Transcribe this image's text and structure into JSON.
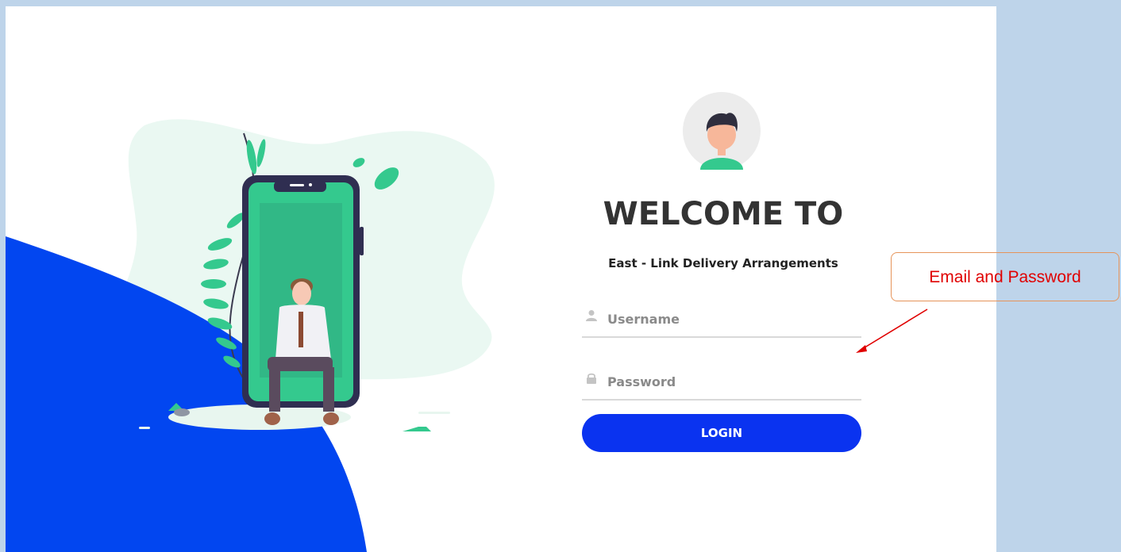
{
  "login": {
    "welcome_title": "WELCOME TO",
    "subtitle": "East - Link Delivery Arrangements",
    "username_placeholder": "Username",
    "password_placeholder": "Password",
    "login_label": "LOGIN"
  },
  "icons": {
    "avatar": "user-avatar-icon",
    "username": "user-icon",
    "password": "lock-icon"
  },
  "annotation": {
    "label": "Email and Password"
  },
  "colors": {
    "accent": "#0a33f0",
    "background_frame": "#bed4ea",
    "illustration_green": "#34c98e",
    "annotation_text": "#e00000",
    "annotation_border": "#e6945a"
  }
}
